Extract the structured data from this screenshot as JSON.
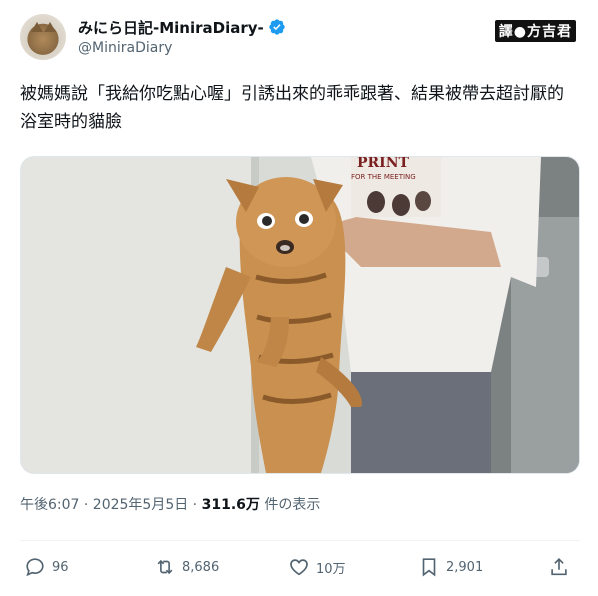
{
  "author": {
    "display_name": "みにら日記-MiniraDiary-",
    "handle": "@MiniraDiary",
    "verified_color": "#1d9bf0"
  },
  "watermark": "譯●方吉君",
  "tweet_text": "被媽媽說「我給你吃點心喔」引誘出來的乖乖跟著、結果被帶去超討厭的浴室時的貓臉",
  "photo": {
    "shirt_print": "FOR THE MEETING"
  },
  "meta": {
    "timestamp": "午後6:07 · 2025年5月5日 ·",
    "views": "311.6万",
    "views_suffix": "件の表示"
  },
  "actions": {
    "replies": "96",
    "reposts": "8,686",
    "likes": "10万",
    "bookmarks": "2,901"
  },
  "icons": [
    "verified-badge-icon",
    "reply-icon",
    "repost-icon",
    "like-icon",
    "bookmark-icon",
    "share-icon"
  ]
}
